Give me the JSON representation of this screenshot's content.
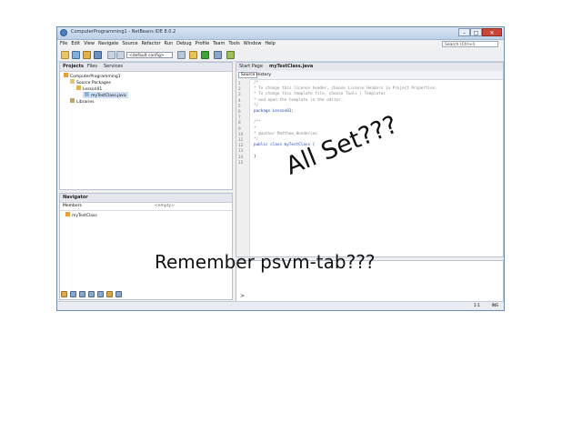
{
  "window": {
    "title": "ComputerProgramming1 - NetBeans IDE 8.0.2",
    "controls": {
      "minimize": "–",
      "maximize": "□",
      "close": "✕"
    }
  },
  "menubar": {
    "items": [
      "File",
      "Edit",
      "View",
      "Navigate",
      "Source",
      "Refactor",
      "Run",
      "Debug",
      "Profile",
      "Team",
      "Tools",
      "Window",
      "Help"
    ],
    "search_placeholder": "Search (Ctrl+I)"
  },
  "toolbar": {
    "config_value": "<default config>"
  },
  "projects_panel": {
    "tabs": [
      "Projects",
      "Files",
      "Services"
    ],
    "tree": [
      "ComputerProgramming1",
      "Source Packages",
      "Lesson01",
      "myTestClass.java",
      "Libraries"
    ]
  },
  "navigator_panel": {
    "tab": "Navigator",
    "members_label": "Members",
    "filter_value": "<empty>",
    "tree": [
      "myTestClass"
    ]
  },
  "editor": {
    "tabs": [
      "Start Page",
      "myTestClass.java"
    ],
    "subtabs": [
      "Source",
      "History"
    ],
    "line_numbers": [
      "1",
      "2",
      "3",
      "4",
      "5",
      "6",
      "7",
      "8",
      "9",
      "10",
      "11",
      "12",
      "13",
      "14",
      "15"
    ],
    "lines": [
      "/*",
      " * To change this license header, choose License Headers in Project Properties.",
      " * To change this template file, choose Tools | Templates",
      " * and open the template in the editor.",
      " */",
      "package Lesson01;",
      "",
      "/**",
      " *",
      " * @author Matthew_Henderson",
      " */",
      "public class myTestClass {",
      "",
      "}",
      ""
    ]
  },
  "output_prompt": ">",
  "statusbar": {
    "position": "1:1",
    "mode": "INS"
  },
  "annotations": {
    "all_set": "All Set???",
    "remember": "Remember psvm-tab???"
  }
}
